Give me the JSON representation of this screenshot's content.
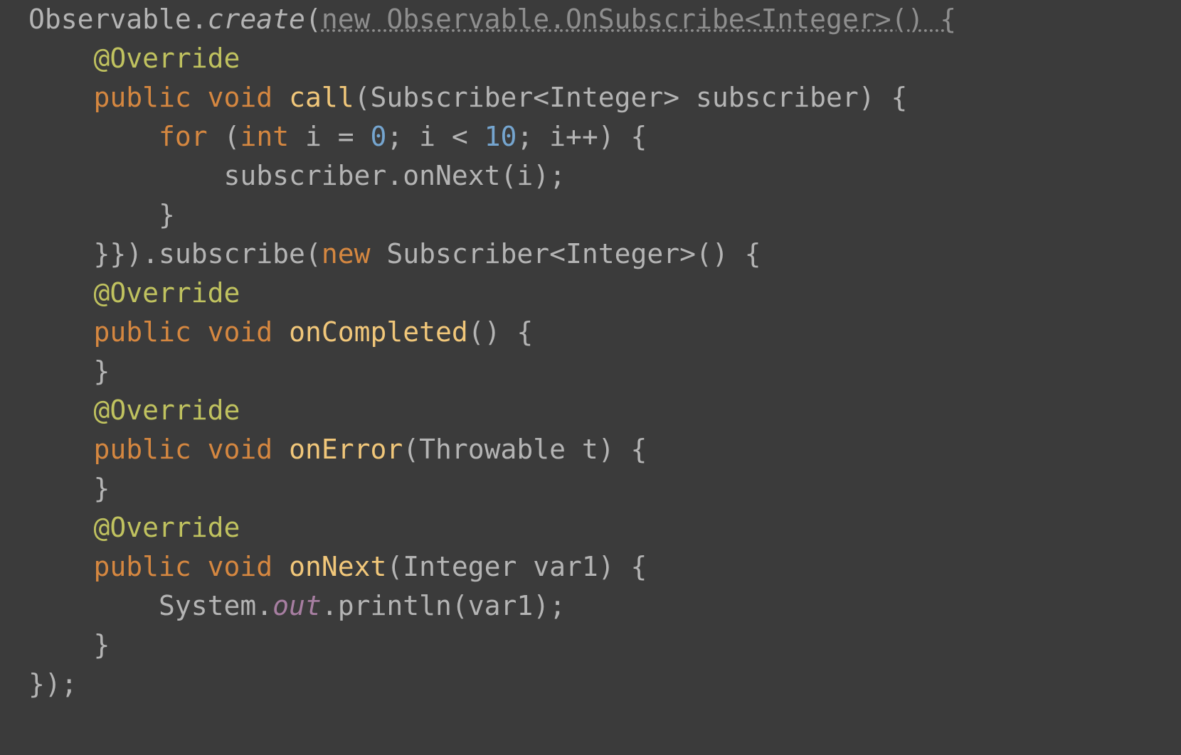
{
  "colors": {
    "background": "#3b3b3b",
    "default_text": "#b4b4b4",
    "dim_text": "#8e8e8e",
    "keyword": "#d58740",
    "annotation": "#c0c25f",
    "function_name": "#f1c77a",
    "number": "#75a5cf",
    "static_field": "#a77ea1"
  },
  "code_lines": [
    [
      {
        "cls": "tok-class",
        "t": "Observable"
      },
      {
        "cls": "tok-punct",
        "t": "."
      },
      {
        "cls": "tok-method-it",
        "t": "create"
      },
      {
        "cls": "tok-punct",
        "t": "("
      },
      {
        "cls": "tok-dim dim-underline",
        "t": "new Observable.OnSubscribe<Integer>() {"
      }
    ],
    [
      {
        "cls": "tok-punct",
        "t": "    "
      },
      {
        "cls": "tok-anno",
        "t": "@Override"
      }
    ],
    [
      {
        "cls": "tok-punct",
        "t": "    "
      },
      {
        "cls": "tok-kw",
        "t": "public void "
      },
      {
        "cls": "tok-fname",
        "t": "call"
      },
      {
        "cls": "tok-punct",
        "t": "(Subscriber<Integer> subscriber) {"
      }
    ],
    [
      {
        "cls": "tok-punct",
        "t": "        "
      },
      {
        "cls": "tok-kw",
        "t": "for "
      },
      {
        "cls": "tok-punct",
        "t": "("
      },
      {
        "cls": "tok-kw",
        "t": "int "
      },
      {
        "cls": "tok-punct",
        "t": "i = "
      },
      {
        "cls": "tok-num",
        "t": "0"
      },
      {
        "cls": "tok-punct",
        "t": "; i < "
      },
      {
        "cls": "tok-num",
        "t": "10"
      },
      {
        "cls": "tok-punct",
        "t": "; i++) {"
      }
    ],
    [
      {
        "cls": "tok-punct",
        "t": "            subscriber.onNext(i);"
      }
    ],
    [
      {
        "cls": "tok-punct",
        "t": "        }"
      }
    ],
    [
      {
        "cls": "tok-punct",
        "t": "    }}).subscribe("
      },
      {
        "cls": "tok-kw",
        "t": "new "
      },
      {
        "cls": "tok-punct",
        "t": "Subscriber<Integer>() {"
      }
    ],
    [
      {
        "cls": "tok-punct",
        "t": "    "
      },
      {
        "cls": "tok-anno",
        "t": "@Override"
      }
    ],
    [
      {
        "cls": "tok-punct",
        "t": "    "
      },
      {
        "cls": "tok-kw",
        "t": "public void "
      },
      {
        "cls": "tok-fname",
        "t": "onCompleted"
      },
      {
        "cls": "tok-punct",
        "t": "() {"
      }
    ],
    [
      {
        "cls": "tok-punct",
        "t": "    }"
      }
    ],
    [
      {
        "cls": "tok-punct",
        "t": "    "
      },
      {
        "cls": "tok-anno",
        "t": "@Override"
      }
    ],
    [
      {
        "cls": "tok-punct",
        "t": "    "
      },
      {
        "cls": "tok-kw",
        "t": "public void "
      },
      {
        "cls": "tok-fname",
        "t": "onError"
      },
      {
        "cls": "tok-punct",
        "t": "(Throwable t) {"
      }
    ],
    [
      {
        "cls": "tok-punct",
        "t": "    }"
      }
    ],
    [
      {
        "cls": "tok-punct",
        "t": "    "
      },
      {
        "cls": "tok-anno",
        "t": "@Override"
      }
    ],
    [
      {
        "cls": "tok-punct",
        "t": "    "
      },
      {
        "cls": "tok-kw",
        "t": "public void "
      },
      {
        "cls": "tok-fname",
        "t": "onNext"
      },
      {
        "cls": "tok-punct",
        "t": "(Integer var1) {"
      }
    ],
    [
      {
        "cls": "tok-punct",
        "t": "        System."
      },
      {
        "cls": "tok-field-it",
        "t": "out"
      },
      {
        "cls": "tok-punct",
        "t": ".println(var1);"
      }
    ],
    [
      {
        "cls": "tok-punct",
        "t": "    }"
      }
    ],
    [
      {
        "cls": "tok-punct",
        "t": "});"
      }
    ]
  ]
}
